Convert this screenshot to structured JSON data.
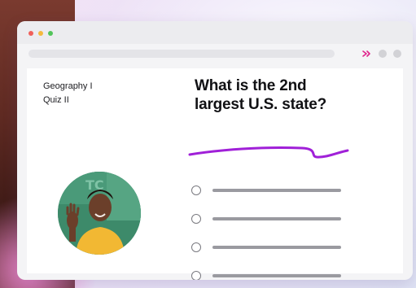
{
  "window": {
    "controls": [
      "close",
      "minimize",
      "maximize"
    ]
  },
  "toolbar": {
    "extension_icon": "double-arrow-icon",
    "extension_color": "#e0218a"
  },
  "quiz": {
    "subject": "Geography I",
    "name": "Quiz II"
  },
  "question": {
    "text_line1": "What is the 2nd",
    "text_line2": "largest U.S. state?",
    "underline_color": "#a020d8"
  },
  "answers": {
    "count": 4,
    "option_labels_visible": false
  },
  "presenter": {
    "icon": "presenter-avatar"
  },
  "colors": {
    "accent": "#a020d8",
    "text": "#111114"
  }
}
